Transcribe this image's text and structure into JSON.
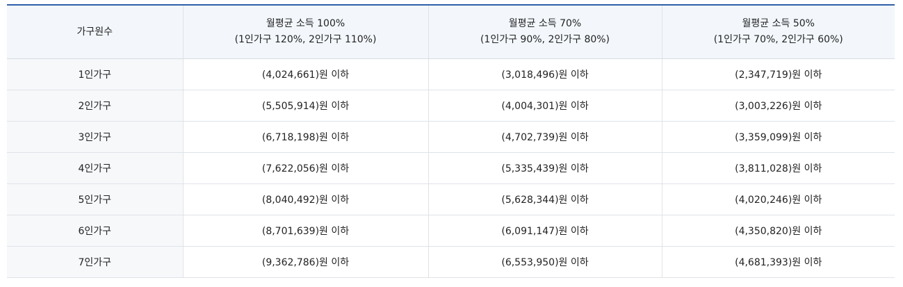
{
  "table": {
    "headers": [
      {
        "lines": [
          "가구원수"
        ]
      },
      {
        "lines": [
          "월평균 소득 100%",
          "(1인가구 120%, 2인가구 110%)"
        ]
      },
      {
        "lines": [
          "월평균 소득 70%",
          "(1인가구 90%, 2인가구 80%)"
        ]
      },
      {
        "lines": [
          "월평균 소득 50%",
          "(1인가구 70%, 2인가구 60%)"
        ]
      }
    ],
    "rows": [
      {
        "household": "1인가구",
        "p100": "(4,024,661)원 이하",
        "p70": "(3,018,496)원 이하",
        "p50": "(2,347,719)원 이하"
      },
      {
        "household": "2인가구",
        "p100": "(5,505,914)원 이하",
        "p70": "(4,004,301)원 이하",
        "p50": "(3,003,226)원 이하"
      },
      {
        "household": "3인가구",
        "p100": "(6,718,198)원 이하",
        "p70": "(4,702,739)원 이하",
        "p50": "(3,359,099)원 이하"
      },
      {
        "household": "4인가구",
        "p100": "(7,622,056)원 이하",
        "p70": "(5,335,439)원 이하",
        "p50": "(3,811,028)원 이하"
      },
      {
        "household": "5인가구",
        "p100": "(8,040,492)원 이하",
        "p70": "(5,628,344)원 이하",
        "p50": "(4,020,246)원 이하"
      },
      {
        "household": "6인가구",
        "p100": "(8,701,639)원 이하",
        "p70": "(6,091,147)원 이하",
        "p50": "(4,350,820)원 이하"
      },
      {
        "household": "7인가구",
        "p100": "(9,362,786)원 이하",
        "p70": "(6,553,950)원 이하",
        "p50": "(4,681,393)원 이하"
      }
    ]
  },
  "colors": {
    "top_border": "#2f5fa8",
    "header_bg": "#f3f7fc",
    "first_col_bg": "#f7f8fa",
    "grid": "#dfe3e8",
    "text": "#222222"
  }
}
